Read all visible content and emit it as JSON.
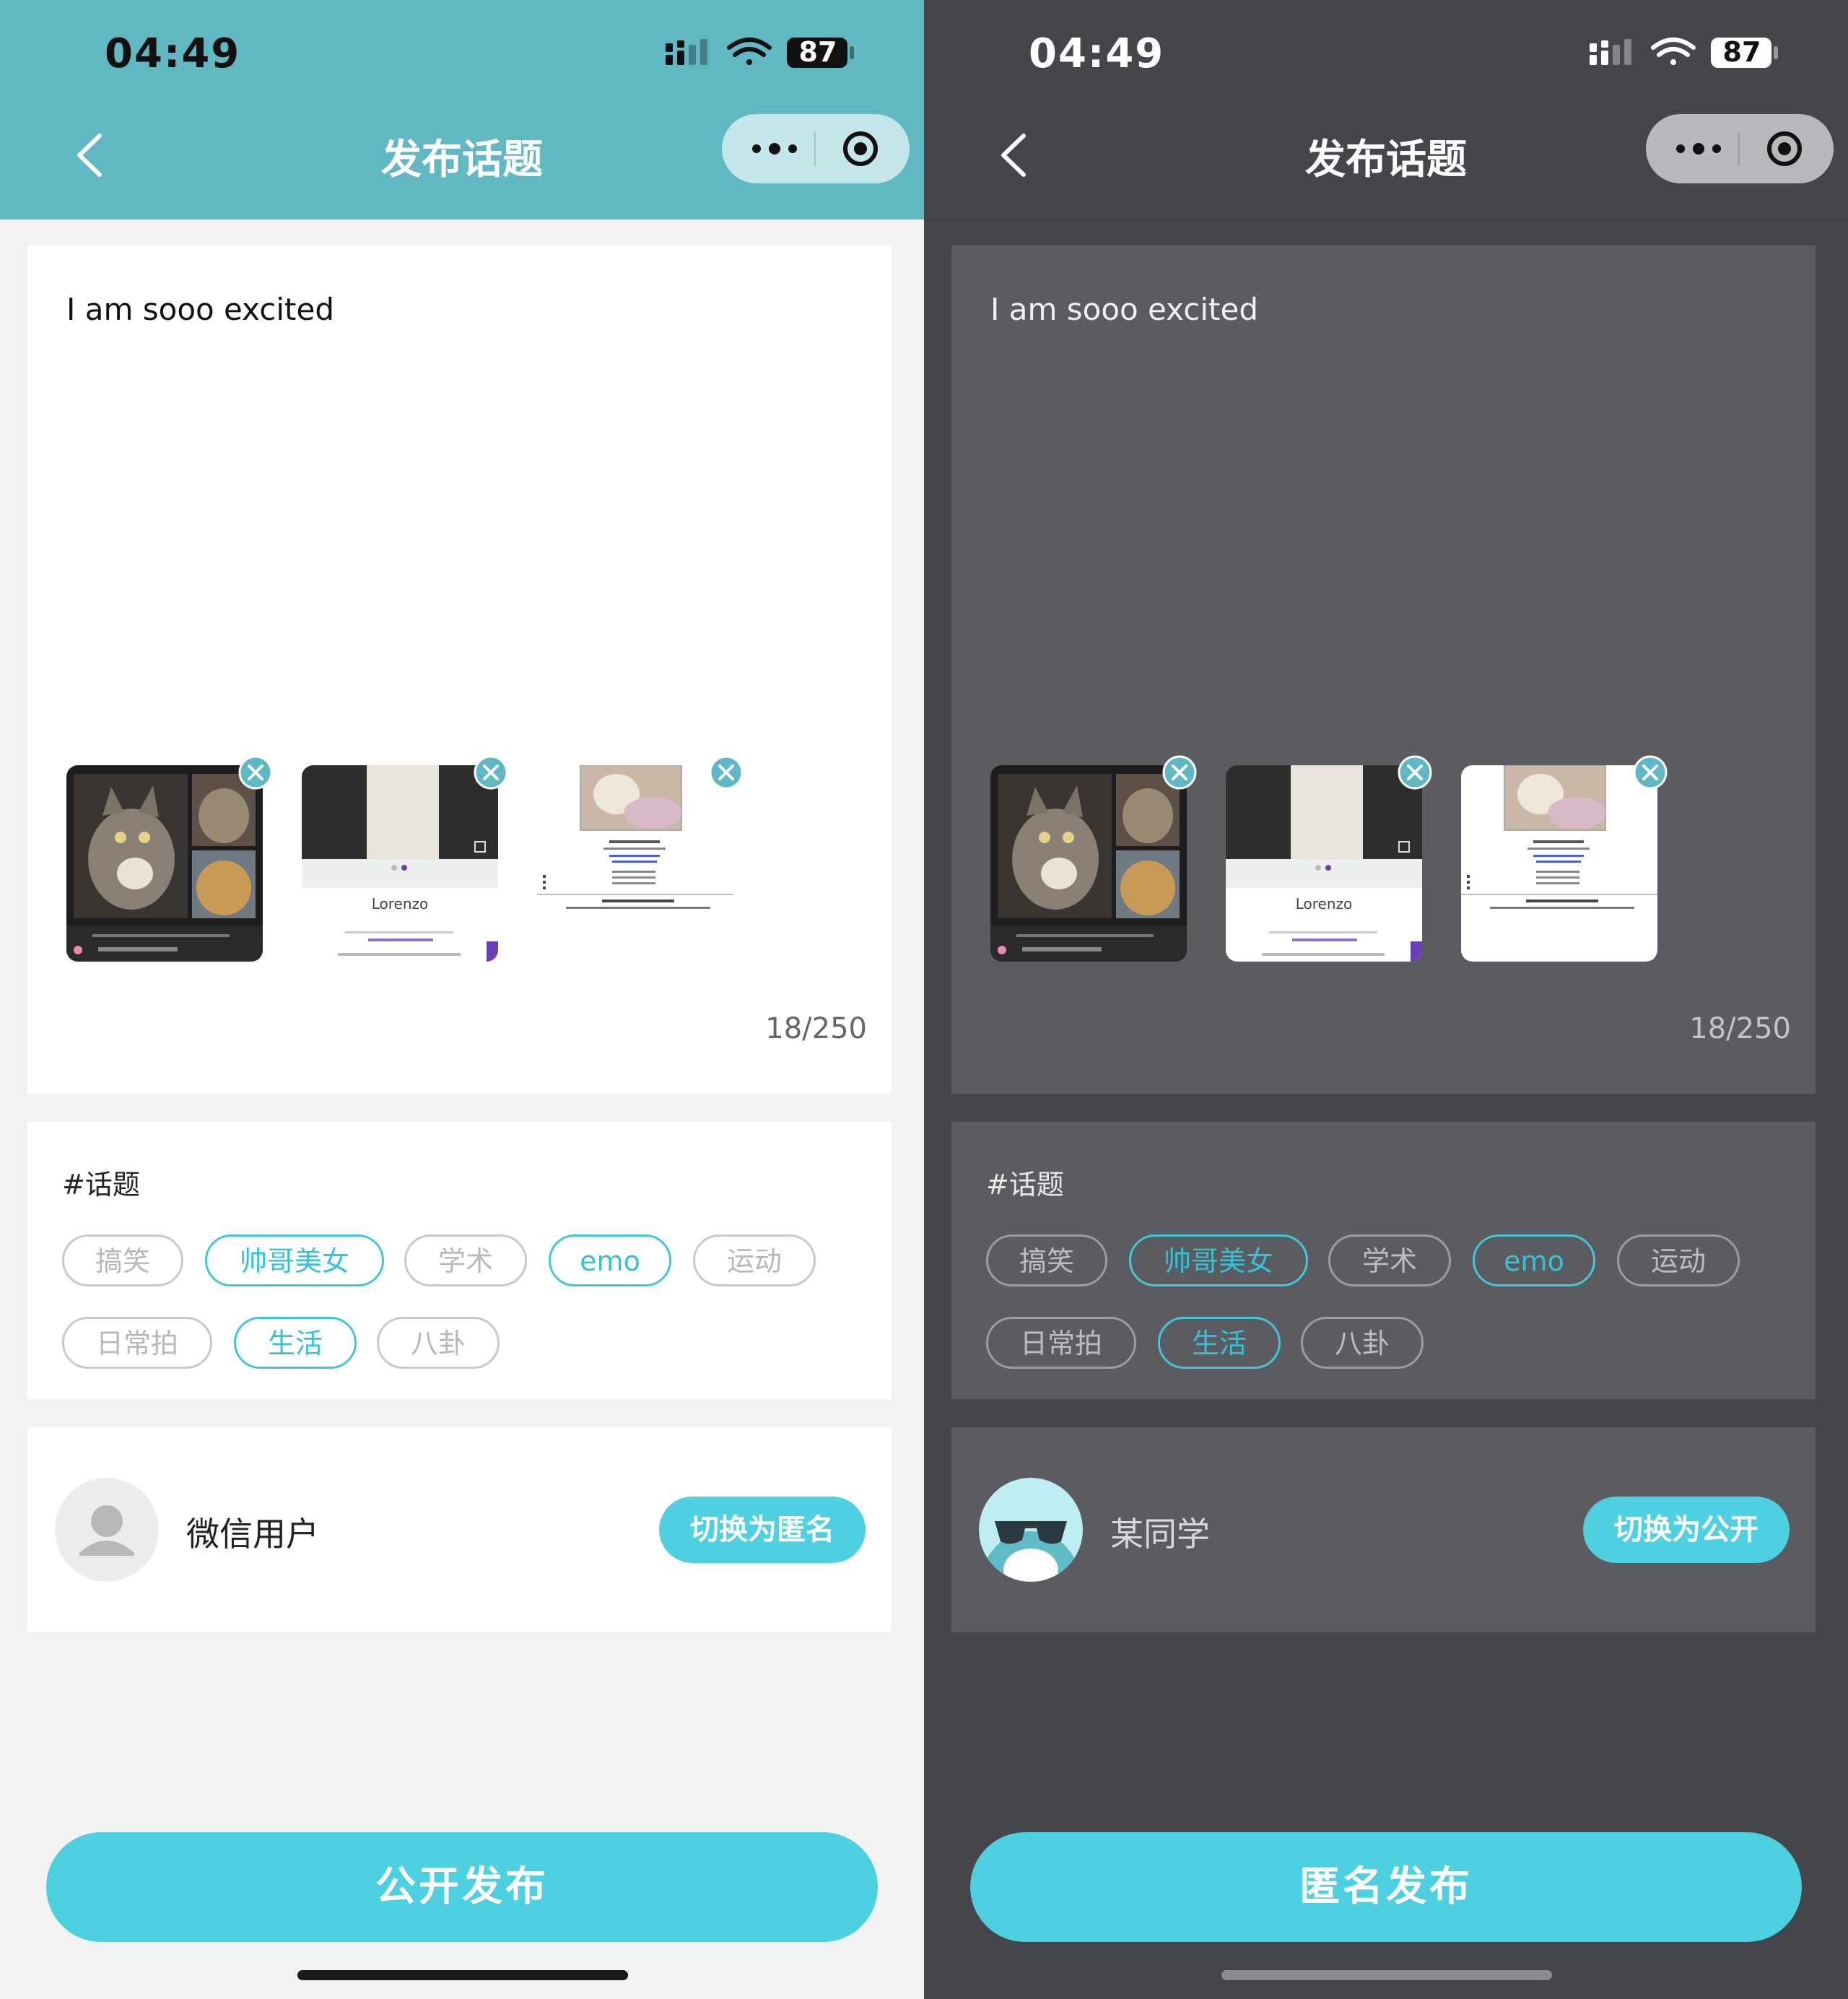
{
  "screens": {
    "light": {
      "status_time": "04:49",
      "battery": "87",
      "title": "发布话题",
      "post_text": "I am sooo excited",
      "char_count": "18/250",
      "topic_header": "#话题",
      "tags": [
        {
          "label": "搞笑",
          "selected": false
        },
        {
          "label": "帅哥美女",
          "selected": true
        },
        {
          "label": "学术",
          "selected": false
        },
        {
          "label": "emo",
          "selected": true
        },
        {
          "label": "运动",
          "selected": false
        },
        {
          "label": "日常拍",
          "selected": false
        },
        {
          "label": "生活",
          "selected": true
        },
        {
          "label": "八卦",
          "selected": false
        }
      ],
      "user_name": "微信用户",
      "switch_label": "切换为匿名",
      "publish_label": "公开发布",
      "thumb_caption": "Lorenzo"
    },
    "dark": {
      "status_time": "04:49",
      "battery": "87",
      "title": "发布话题",
      "post_text": "I am sooo excited",
      "char_count": "18/250",
      "topic_header": "#话题",
      "tags": [
        {
          "label": "搞笑",
          "selected": false
        },
        {
          "label": "帅哥美女",
          "selected": true
        },
        {
          "label": "学术",
          "selected": false
        },
        {
          "label": "emo",
          "selected": true
        },
        {
          "label": "运动",
          "selected": false
        },
        {
          "label": "日常拍",
          "selected": false
        },
        {
          "label": "生活",
          "selected": true
        },
        {
          "label": "八卦",
          "selected": false
        }
      ],
      "user_name": "某同学",
      "switch_label": "切换为公开",
      "publish_label": "匿名发布",
      "thumb_caption": "Lorenzo"
    }
  },
  "colors": {
    "accent": "#4ccfdf",
    "light_header": "#61b8c2",
    "dark_background": "#45464b",
    "dark_card": "#5b5c61"
  }
}
